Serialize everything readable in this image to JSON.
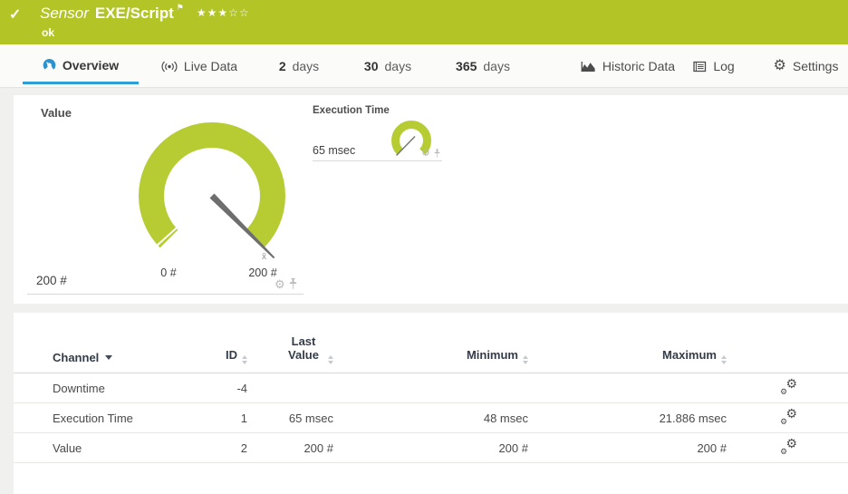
{
  "colors": {
    "status_green": "#b2c426",
    "gauge_green": "#b7cb33",
    "accent_blue": "#2e9fd4"
  },
  "header": {
    "check": "✓",
    "title_kind": "Sensor",
    "title": "EXE/Script",
    "flag": "⚑",
    "rating_filled": "★★★",
    "rating_empty": "☆☆",
    "status": "ok"
  },
  "tabs": [
    {
      "label": "Overview",
      "icon": "gauge-icon",
      "active": true
    },
    {
      "label": "Live Data",
      "icon": "broadcast-icon"
    },
    {
      "num": "2",
      "unit": "days"
    },
    {
      "num": "30",
      "unit": "days"
    },
    {
      "num": "365",
      "unit": "days"
    },
    {
      "label": "Historic Data",
      "icon": "area-chart-icon"
    },
    {
      "label": "Log",
      "icon": "log-icon"
    },
    {
      "label": "Settings",
      "icon": "gear-icon"
    }
  ],
  "widgets": {
    "value": {
      "title": "Value",
      "current": "200 #",
      "scale_min": "0 #",
      "scale_max": "200 #",
      "average_marker": "x̄",
      "gauge_value": 200,
      "gauge_min": 0,
      "gauge_max": 200
    },
    "execution_time": {
      "title": "Execution Time",
      "current": "65 msec"
    },
    "tool_gear": "⚙"
  },
  "table": {
    "columns": {
      "channel": "Channel",
      "id": "ID",
      "last_value": "Last Value",
      "minimum": "Minimum",
      "maximum": "Maximum"
    },
    "rows": [
      {
        "channel": "Downtime",
        "id": "-4",
        "last_value": "",
        "minimum": "",
        "maximum": ""
      },
      {
        "channel": "Execution Time",
        "id": "1",
        "last_value": "65 msec",
        "minimum": "48 msec",
        "maximum": "21.886 msec"
      },
      {
        "channel": "Value",
        "id": "2",
        "last_value": "200 #",
        "minimum": "200 #",
        "maximum": "200 #"
      }
    ],
    "row_action_gear": "⚙"
  }
}
